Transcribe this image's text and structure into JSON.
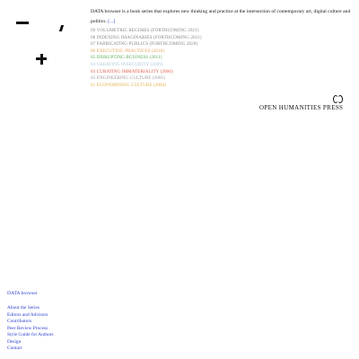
{
  "logo": {
    "glyph": "plus"
  },
  "intro": {
    "text": "DATA browser is a book series that explores new thinking and practice at the intersection of contemporary art, digital culture and politics.",
    "more_link": "[...]"
  },
  "volumes": [
    {
      "label": "09 VOLUMETRIC REGIMES (FORTHCOMING 2021)",
      "color": "#8a8a8a"
    },
    {
      "label": "08 INDEXING IMAGINARIES (FORTHCOMING 2021)",
      "color": "#8a8a8a"
    },
    {
      "label": "07 FABRICATING PUBLICS (FORTHCOMING 2020)",
      "color": "#8a8a8a"
    },
    {
      "label": "06 EXECUTING PRACTICES (2018)",
      "color": "#e6a35c"
    },
    {
      "label": "05 DISRUPTING BUSINESS (2011)",
      "color": "#5fae57"
    },
    {
      "label": "04 CREATING INSECURITY (2009)",
      "color": "#a9c9da"
    },
    {
      "label": "03 CURATING IMMATERIALITY (2006)",
      "color": "#e25c4c"
    },
    {
      "label": "02 ENGINEERING CULTURE (2005)",
      "color": "#9a9a9a"
    },
    {
      "label": "01 ECONOMISING CULTURE (2004)",
      "color": "#e2b24a"
    }
  ],
  "publisher": {
    "name": "OPEN HUMANITIES PRESS"
  },
  "footer": {
    "title": "DATA browser",
    "links": [
      "About the Series",
      "Editors and Advisors",
      "Contributors",
      "Peer Review Process",
      "Style Guide for Authors",
      "Design",
      "Contact"
    ]
  }
}
